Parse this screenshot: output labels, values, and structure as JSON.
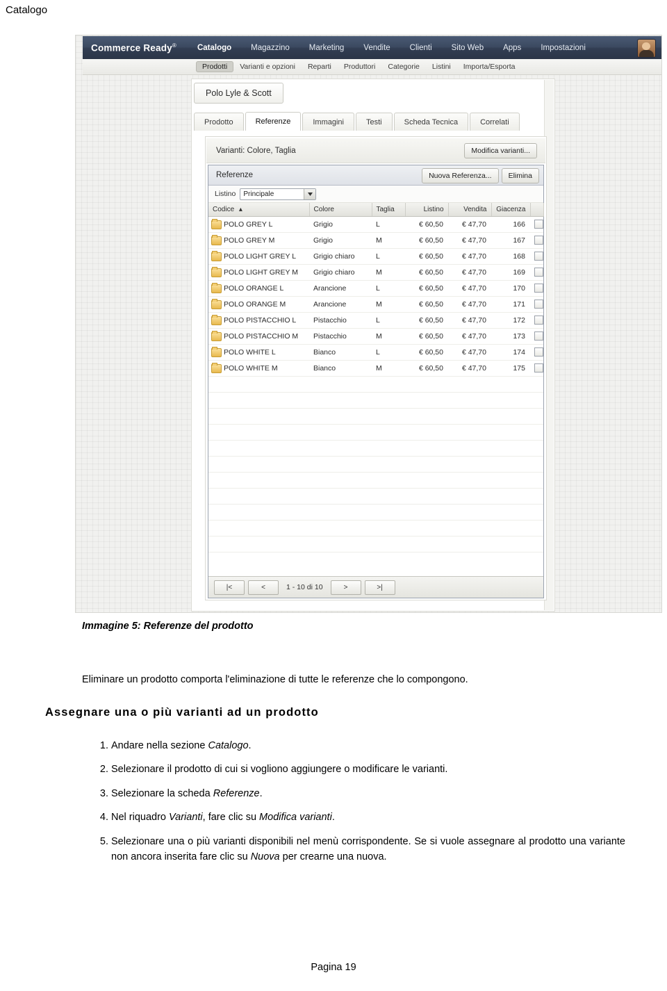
{
  "document": {
    "running_header": "Catalogo",
    "footer": "Pagina 19",
    "figure_caption": "Immagine 5: Referenze del prodotto",
    "paragraph": "Eliminare un prodotto comporta l'eliminazione di tutte le referenze che lo compongono.",
    "section_heading": "Assegnare una o più varianti ad un prodotto",
    "steps": [
      "Andare nella sezione Catalogo.",
      "Selezionare il prodotto di cui si vogliono aggiungere o modificare le varianti.",
      "Selezionare la scheda Referenze.",
      "Nel riquadro Varianti, fare clic su Modifica varianti.",
      "Selezionare una o più varianti disponibili nel menù corrispondente. Se si vuole assegnare al prodotto una variante non ancora inserita fare clic su Nuova per crearne una nuova."
    ]
  },
  "screenshot": {
    "brand": "Commerce Ready",
    "brand_sup": "®",
    "topnav": [
      {
        "label": "Catalogo",
        "active": true
      },
      {
        "label": "Magazzino",
        "active": false
      },
      {
        "label": "Marketing",
        "active": false
      },
      {
        "label": "Vendite",
        "active": false
      },
      {
        "label": "Clienti",
        "active": false
      },
      {
        "label": "Sito Web",
        "active": false
      },
      {
        "label": "Apps",
        "active": false
      },
      {
        "label": "Impostazioni",
        "active": false
      }
    ],
    "subnav": [
      {
        "label": "Prodotti",
        "selected": true
      },
      {
        "label": "Varianti e opzioni",
        "selected": false
      },
      {
        "label": "Reparti",
        "selected": false
      },
      {
        "label": "Produttori",
        "selected": false
      },
      {
        "label": "Categorie",
        "selected": false
      },
      {
        "label": "Listini",
        "selected": false
      },
      {
        "label": "Importa/Esporta",
        "selected": false
      }
    ],
    "product_tab": "Polo Lyle & Scott",
    "tabs": [
      {
        "label": "Prodotto",
        "active": false
      },
      {
        "label": "Referenze",
        "active": true
      },
      {
        "label": "Immagini",
        "active": false
      },
      {
        "label": "Testi",
        "active": false
      },
      {
        "label": "Scheda Tecnica",
        "active": false
      },
      {
        "label": "Correlati",
        "active": false
      }
    ],
    "variants_panel": {
      "label": "Varianti: Colore, Taglia",
      "button": "Modifica varianti..."
    },
    "references_panel": {
      "title": "Referenze",
      "new_button": "Nuova Referenza...",
      "delete_button": "Elimina",
      "listino_label": "Listino",
      "listino_value": "Principale",
      "columns": [
        "Codice",
        "Colore",
        "Taglia",
        "Listino",
        "Vendita",
        "Giacenza",
        ""
      ],
      "sort_column": "Codice",
      "sort_direction": "asc",
      "rows": [
        {
          "codice": "POLO GREY L",
          "colore": "Grigio",
          "taglia": "L",
          "listino": "€ 60,50",
          "vendita": "€ 47,70",
          "giacenza": "166"
        },
        {
          "codice": "POLO GREY M",
          "colore": "Grigio",
          "taglia": "M",
          "listino": "€ 60,50",
          "vendita": "€ 47,70",
          "giacenza": "167"
        },
        {
          "codice": "POLO LIGHT GREY L",
          "colore": "Grigio chiaro",
          "taglia": "L",
          "listino": "€ 60,50",
          "vendita": "€ 47,70",
          "giacenza": "168"
        },
        {
          "codice": "POLO LIGHT GREY M",
          "colore": "Grigio chiaro",
          "taglia": "M",
          "listino": "€ 60,50",
          "vendita": "€ 47,70",
          "giacenza": "169"
        },
        {
          "codice": "POLO ORANGE L",
          "colore": "Arancione",
          "taglia": "L",
          "listino": "€ 60,50",
          "vendita": "€ 47,70",
          "giacenza": "170"
        },
        {
          "codice": "POLO ORANGE M",
          "colore": "Arancione",
          "taglia": "M",
          "listino": "€ 60,50",
          "vendita": "€ 47,70",
          "giacenza": "171"
        },
        {
          "codice": "POLO PISTACCHIO L",
          "colore": "Pistacchio",
          "taglia": "L",
          "listino": "€ 60,50",
          "vendita": "€ 47,70",
          "giacenza": "172"
        },
        {
          "codice": "POLO PISTACCHIO M",
          "colore": "Pistacchio",
          "taglia": "M",
          "listino": "€ 60,50",
          "vendita": "€ 47,70",
          "giacenza": "173"
        },
        {
          "codice": "POLO WHITE L",
          "colore": "Bianco",
          "taglia": "L",
          "listino": "€ 60,50",
          "vendita": "€ 47,70",
          "giacenza": "174"
        },
        {
          "codice": "POLO WHITE M",
          "colore": "Bianco",
          "taglia": "M",
          "listino": "€ 60,50",
          "vendita": "€ 47,70",
          "giacenza": "175"
        }
      ],
      "pager": {
        "first": "|<",
        "prev": "<",
        "info": "1 - 10 di 10",
        "next": ">",
        "last": ">|"
      }
    }
  }
}
